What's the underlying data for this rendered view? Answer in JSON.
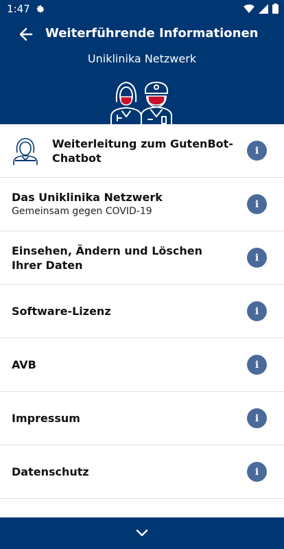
{
  "status_bar": {
    "time": "1:47"
  },
  "header": {
    "title": "Weiterführende Informationen",
    "subtitle": "Uniklinika Netzwerk"
  },
  "items": [
    {
      "title": "Weiterleitung zum GutenBot-Chatbot",
      "subtitle": "",
      "info": "i"
    },
    {
      "title": "Das Uniklinika Netzwerk",
      "subtitle": "Gemeinsam gegen COVID-19",
      "info": "i"
    },
    {
      "title": "Einsehen, Ändern und Löschen Ihrer Daten",
      "subtitle": "",
      "info": "i"
    },
    {
      "title": "Software-Lizenz",
      "subtitle": "",
      "info": "i"
    },
    {
      "title": "AVB",
      "subtitle": "",
      "info": "i"
    },
    {
      "title": "Impressum",
      "subtitle": "",
      "info": "i"
    },
    {
      "title": "Datenschutz",
      "subtitle": "",
      "info": "i"
    }
  ],
  "colors": {
    "primary": "#003671",
    "info_button": "#4a6a9a",
    "accent_red": "#c8102e"
  }
}
